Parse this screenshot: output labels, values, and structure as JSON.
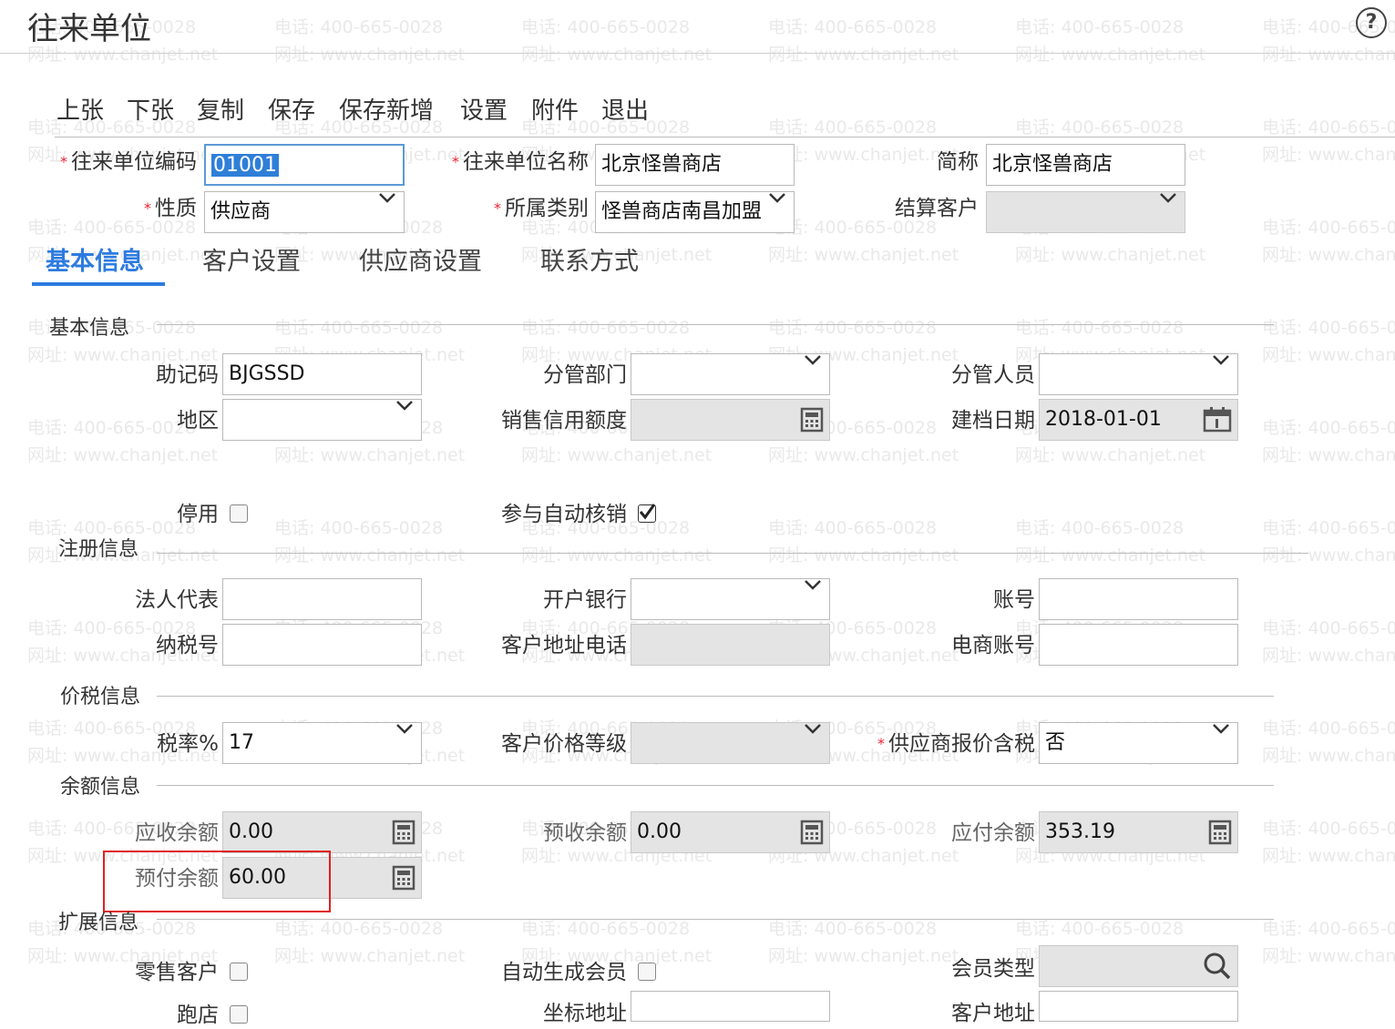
{
  "title": "往来单位",
  "help_symbol": "?",
  "watermark": {
    "phone": "电话: 400-665-0028",
    "site": "网址: www.chanjet.net"
  },
  "toolbar": [
    "上张",
    "下张",
    "复制",
    "保存",
    "保存新增",
    "设置",
    "附件",
    "退出"
  ],
  "header": {
    "code": {
      "label": "往来单位编码",
      "value": "01001"
    },
    "name": {
      "label": "往来单位名称",
      "value": "北京怪兽商店"
    },
    "short": {
      "label": "简称",
      "value": "北京怪兽商店"
    },
    "nature": {
      "label": "性质",
      "value": "供应商"
    },
    "category": {
      "label": "所属类别",
      "value": "怪兽商店南昌加盟"
    },
    "settle": {
      "label": "结算客户",
      "value": ""
    }
  },
  "tabs": [
    "基本信息",
    "客户设置",
    "供应商设置",
    "联系方式"
  ],
  "sections": {
    "basic": "基本信息",
    "register": "注册信息",
    "tax": "价税信息",
    "balance": "余额信息",
    "ext": "扩展信息"
  },
  "basic": {
    "mnemonic": {
      "label": "助记码",
      "value": "BJGSSD"
    },
    "dept": {
      "label": "分管部门",
      "value": ""
    },
    "staff": {
      "label": "分管人员",
      "value": ""
    },
    "region": {
      "label": "地区",
      "value": ""
    },
    "credit": {
      "label": "销售信用额度",
      "value": ""
    },
    "created": {
      "label": "建档日期",
      "value": "2018-01-01"
    },
    "disabled": {
      "label": "停用",
      "checked": false
    },
    "autowrite": {
      "label": "参与自动核销",
      "checked": true
    }
  },
  "register": {
    "legal": {
      "label": "法人代表",
      "value": ""
    },
    "bank": {
      "label": "开户银行",
      "value": ""
    },
    "account": {
      "label": "账号",
      "value": ""
    },
    "taxno": {
      "label": "纳税号",
      "value": ""
    },
    "addrphone": {
      "label": "客户地址电话",
      "value": ""
    },
    "ecom": {
      "label": "电商账号",
      "value": ""
    }
  },
  "tax": {
    "rate": {
      "label": "税率%",
      "value": "17"
    },
    "pricelevel": {
      "label": "客户价格等级",
      "value": ""
    },
    "quote": {
      "label": "供应商报价含税",
      "value": "否"
    }
  },
  "balance": {
    "receivable": {
      "label": "应收余额",
      "value": "0.00"
    },
    "prereceive": {
      "label": "预收余额",
      "value": "0.00"
    },
    "payable": {
      "label": "应付余额",
      "value": "353.19"
    },
    "prepay": {
      "label": "预付余额",
      "value": "60.00"
    }
  },
  "ext": {
    "retail": {
      "label": "零售客户",
      "checked": false
    },
    "automember": {
      "label": "自动生成会员",
      "checked": false
    },
    "membertype": {
      "label": "会员类型",
      "value": ""
    },
    "store": {
      "label": "跑店",
      "checked": false
    },
    "coord": {
      "label": "坐标地址",
      "value": ""
    },
    "custaddr": {
      "label": "客户地址",
      "value": ""
    }
  }
}
